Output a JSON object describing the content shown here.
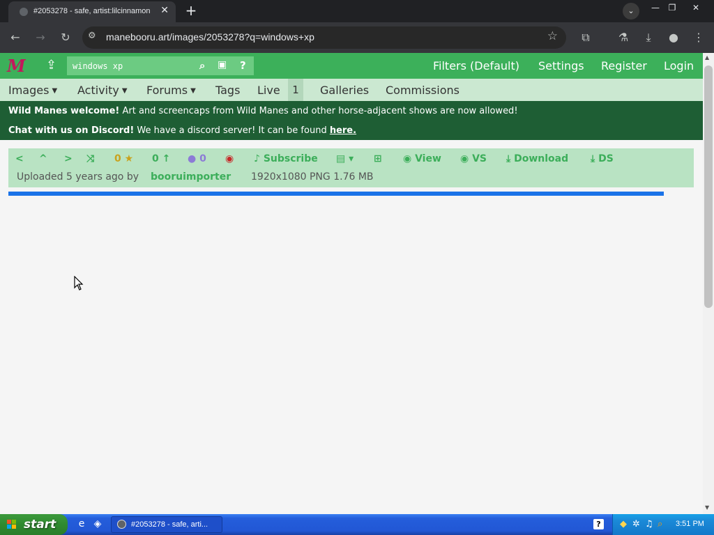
{
  "browser": {
    "tab_title": "#2053278 - safe, artist:lilcinnamon",
    "tab_close": "✕",
    "new_tab": "+",
    "url": "manebooru.art/images/2053278?q=windows+xp",
    "window_controls": {
      "minimize": "—",
      "restore": "❐",
      "close": "✕"
    }
  },
  "site": {
    "logo": "M",
    "search": {
      "value": "windows xp",
      "placeholder": ""
    },
    "header_links": [
      "Filters (Default)",
      "Settings",
      "Register",
      "Login"
    ],
    "nav": [
      {
        "label": "Images",
        "dropdown": true
      },
      {
        "label": "Activity",
        "dropdown": true
      },
      {
        "label": "Forums",
        "dropdown": true
      },
      {
        "label": "Tags",
        "dropdown": false
      },
      {
        "label": "Live",
        "dropdown": false
      },
      {
        "label": "Galleries",
        "dropdown": false
      },
      {
        "label": "Commissions",
        "dropdown": false
      }
    ],
    "live_count": "1",
    "notices": [
      {
        "bold": "Wild Manes welcome!",
        "text": " Art and screencaps from Wild Manes and other horse-adjacent shows are now allowed!"
      },
      {
        "bold": "Chat with us on Discord!",
        "text": " We have a discord server! It can be found ",
        "link": "here."
      }
    ]
  },
  "image_meta": {
    "faves": "0",
    "upvotes": "0",
    "comments": "0",
    "subscribe": "Subscribe",
    "view": "View",
    "vs": "VS",
    "download": "Download",
    "ds": "DS",
    "uploaded_text": "Uploaded 5 years ago by",
    "uploader": "booruimporter",
    "dimensions": "1920x1080 PNG 1.76 MB"
  },
  "taskbar": {
    "start": "start",
    "task_title": "#2053278 - safe, arti...",
    "clock": "3:51 PM"
  },
  "colors": {
    "header_green": "#3cb05a",
    "nav_bg": "#cbe8d1",
    "notice_bg": "#1e5e34",
    "metabar_bg": "#b9e3c3",
    "progress_blue": "#1a73e8"
  }
}
